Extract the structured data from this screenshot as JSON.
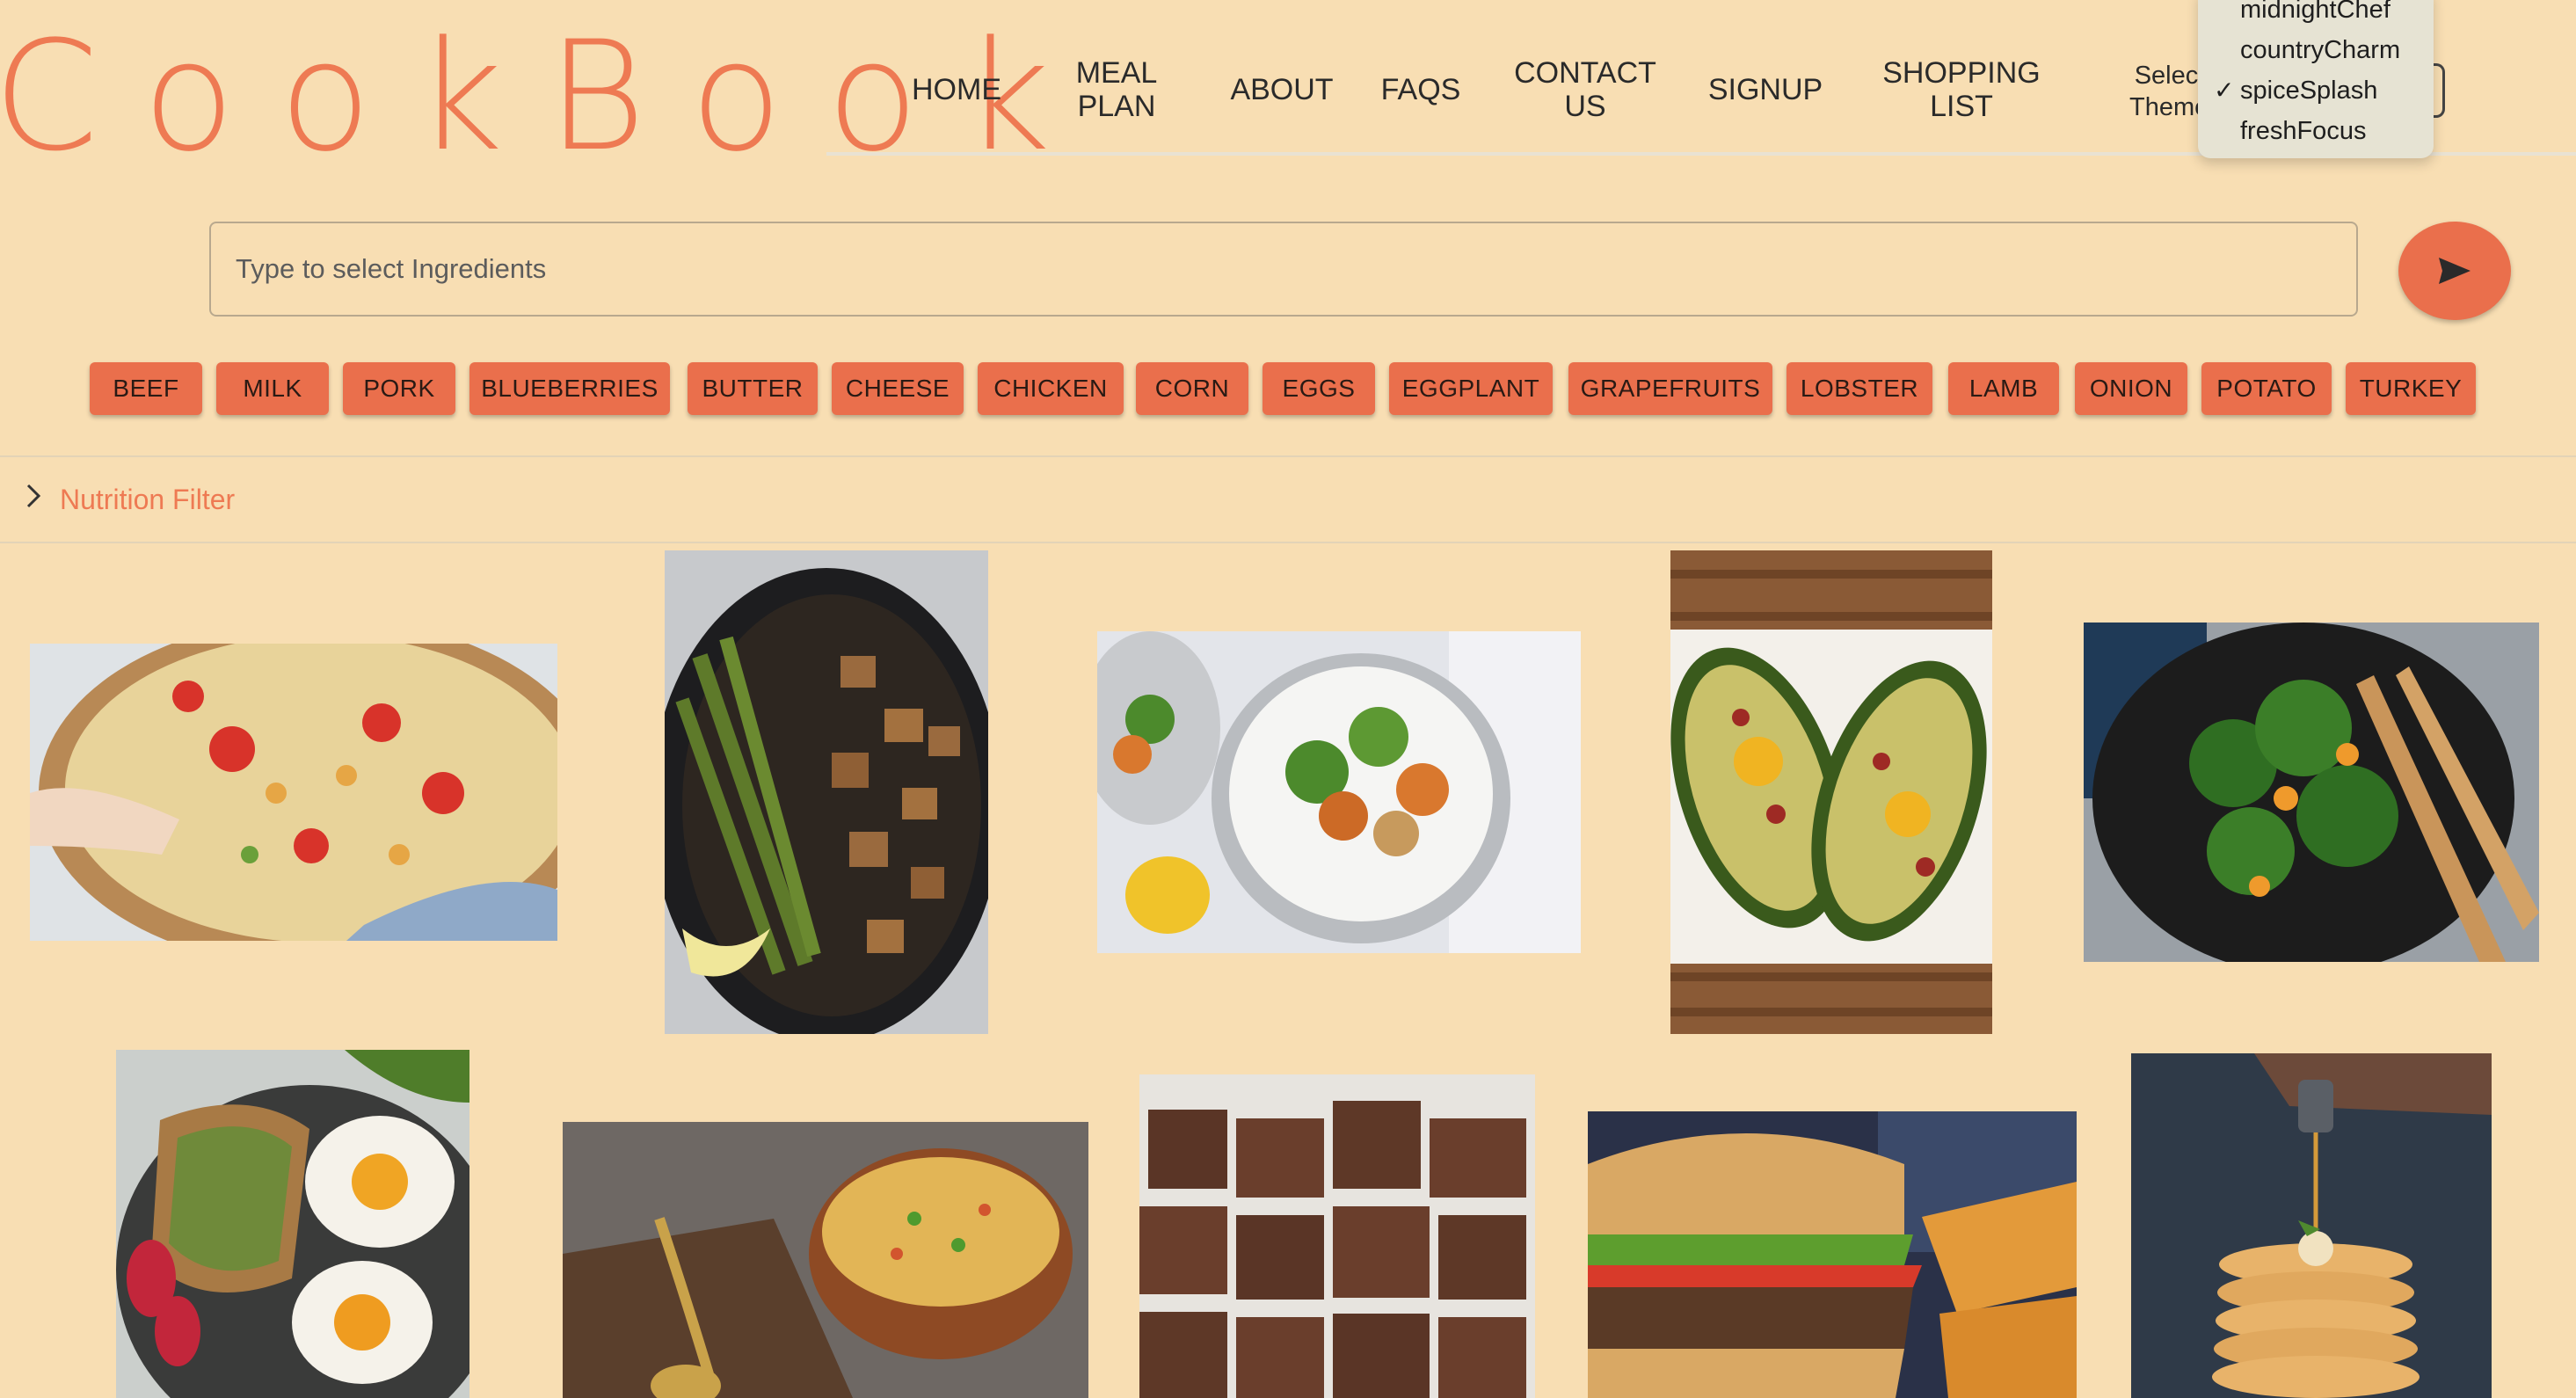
{
  "brand": {
    "logo": "CookBook"
  },
  "nav": [
    {
      "label": "HOME"
    },
    {
      "label": "MEAL\nPLAN"
    },
    {
      "label": "ABOUT"
    },
    {
      "label": "FAQS"
    },
    {
      "label": "CONTACT\nUS"
    },
    {
      "label": "SIGNUP"
    },
    {
      "label": "SHOPPING\nLIST"
    }
  ],
  "theme": {
    "label": "Select\nTheme:",
    "options": [
      "midnightChef",
      "countryCharm",
      "spiceSplash",
      "freshFocus"
    ],
    "selected": "spiceSplash",
    "check": "✓"
  },
  "search": {
    "placeholder": "Type to select Ingredients",
    "send_icon": "send-icon"
  },
  "ingredients": [
    "BEEF",
    "MILK",
    "PORK",
    "BLUEBERRIES",
    "BUTTER",
    "CHEESE",
    "CHICKEN",
    "CORN",
    "EGGS",
    "EGGPLANT",
    "GRAPEFRUITS",
    "LOBSTER",
    "LAMB",
    "ONION",
    "POTATO",
    "TURKEY"
  ],
  "nutrition_filter": {
    "label": "Nutrition Filter",
    "icon": "chevron-right-icon"
  },
  "recipes": [
    {
      "name": "chickpea-salad"
    },
    {
      "name": "chicken-asparagus-skillet"
    },
    {
      "name": "chicken-rice-bowl"
    },
    {
      "name": "bacon-egg-avocado"
    },
    {
      "name": "spinach-orange-salad"
    },
    {
      "name": "avocado-toast-eggs"
    },
    {
      "name": "vegetable-rice-pot"
    },
    {
      "name": "brownies"
    },
    {
      "name": "burger-and-chips"
    },
    {
      "name": "pancake-stack"
    }
  ],
  "colors": {
    "accent": "#ea6f4c",
    "logo": "#ee7a53",
    "background": "#f8deb3"
  }
}
